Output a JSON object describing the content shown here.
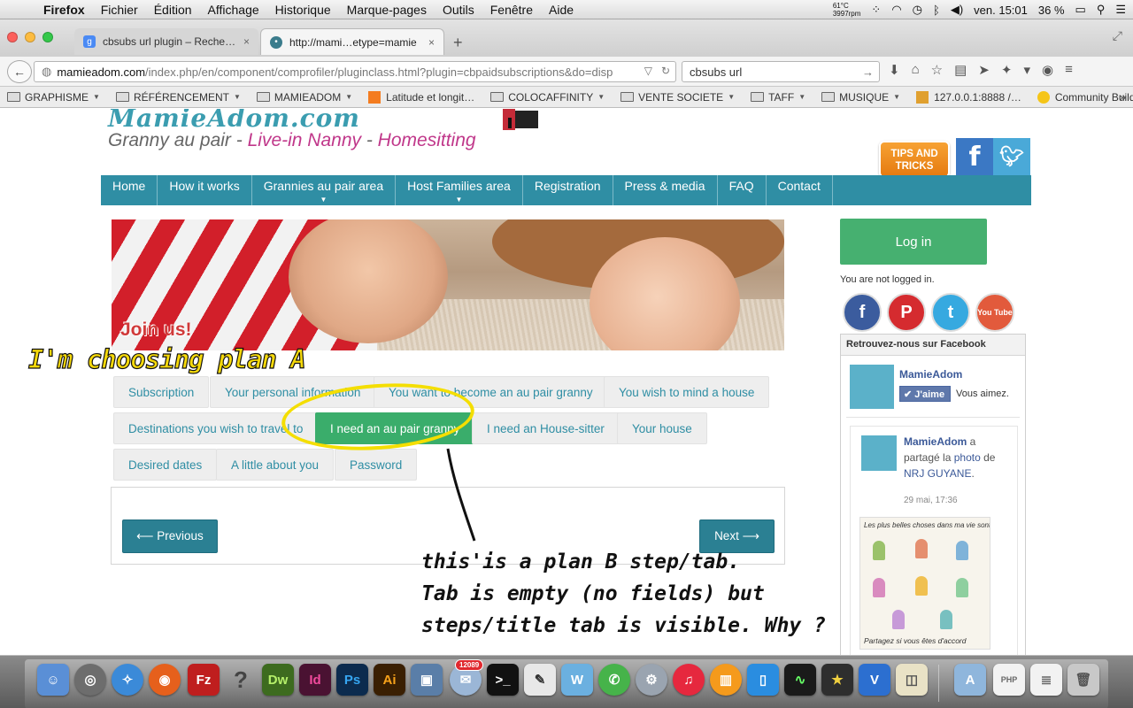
{
  "menubar": {
    "app": "Firefox",
    "items": [
      "Fichier",
      "Édition",
      "Affichage",
      "Historique",
      "Marque-pages",
      "Outils",
      "Fenêtre",
      "Aide"
    ],
    "temp_line1": "61°C",
    "temp_line2": "3997rpm",
    "datetime": "ven. 15:01",
    "battery": "36 %"
  },
  "tabs": [
    {
      "title": "cbsubs url plugin – Reche…",
      "close": "×"
    },
    {
      "title": "http://mami…etype=mamie",
      "close": "×"
    }
  ],
  "newtab": "+",
  "address": {
    "host": "mamieadom.com",
    "path": "/index.php/en/component/comprofiler/pluginclass.html?plugin=cbpaidsubscriptions&do=disp"
  },
  "search": {
    "value": "cbsubs url"
  },
  "bookmarks": [
    {
      "label": "GRAPHISME",
      "folder": true
    },
    {
      "label": "RÉFÉRENCEMENT",
      "folder": true
    },
    {
      "label": "MAMIEADOM",
      "folder": true
    },
    {
      "label": "Latitude et longit…",
      "folder": false
    },
    {
      "label": "COLOCAFFINITY",
      "folder": true
    },
    {
      "label": "VENTE SOCIETE",
      "folder": true
    },
    {
      "label": "TAFF",
      "folder": true
    },
    {
      "label": "MUSIQUE",
      "folder": true
    },
    {
      "label": "127.0.0.1:8888 /…",
      "folder": false
    },
    {
      "label": "Community Build…",
      "folder": false
    }
  ],
  "site": {
    "logo": "MamieAdom.com",
    "tagline": [
      "Granny au pair",
      " - ",
      "Live-in Nanny",
      " - ",
      "Homesitting"
    ],
    "tips": "TIPS AND TRICKS",
    "nav": [
      "Home",
      "How it works",
      "Grannies au pair area",
      "Host Families area",
      "Registration",
      "Press & media",
      "FAQ",
      "Contact"
    ],
    "banner_title": "Join us!"
  },
  "step_tabs": [
    "Subscription",
    "Your personal information",
    "You want to become an au pair granny",
    "You wish to mind a house",
    "Destinations you wish to travel to",
    "I need an au pair granny",
    "I need an House-sitter",
    "Your house",
    "Desired dates",
    "A little about you",
    "Password"
  ],
  "active_step": "I need an au pair granny",
  "buttons": {
    "prev": "⟵ Previous",
    "next": "Next ⟶"
  },
  "annotations": {
    "plan_a": "I'm choosing plan A",
    "plan_b": "this'is a plan B step/tab.\nTab is empty (no fields) but\nsteps/title tab is visible. Why ?"
  },
  "sidebar": {
    "login": "Log in",
    "not_logged": "You are not logged in.",
    "social": [
      "f",
      "P",
      "t",
      "You\nTube"
    ],
    "fb_header": "Retrouvez-nous sur Facebook",
    "fb_page_name": "MamieAdom",
    "fb_like": "✔ J'aime",
    "fb_vous": "Vous aimez.",
    "post_author": "MamieAdom",
    "post_mid1": " a partagé la ",
    "post_link1": "photo",
    "post_mid2": " de ",
    "post_link2": "NRJ GUYANE",
    "post_end": ".",
    "post_time": "29 mai, 17:36",
    "post_img_top": "Les plus belles choses dans ma vie sont gratuites",
    "post_img_bottom": "Partagez si vous êtes d'accord"
  },
  "dock_badge": "12089",
  "colors": {
    "nav_teal": "#2f8ea4",
    "active_green": "#3aad6b",
    "login_green": "#46b070",
    "annotation_yellow": "#f4de00"
  }
}
